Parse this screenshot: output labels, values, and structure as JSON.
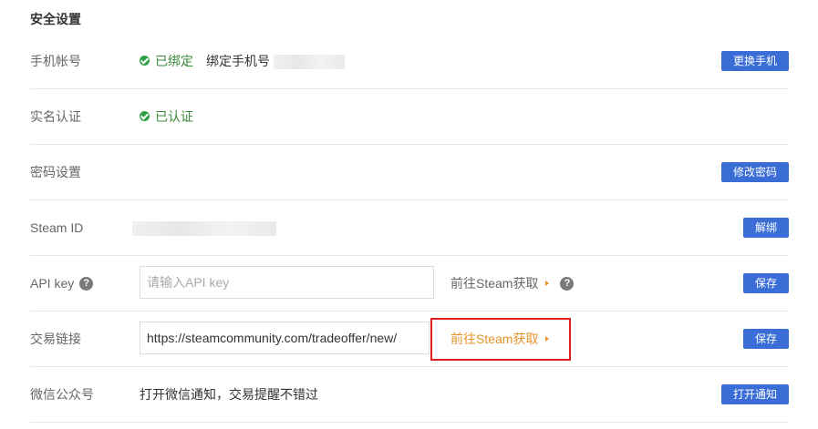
{
  "section_title": "安全设置",
  "phone": {
    "label": "手机帐号",
    "status": "已绑定",
    "bind_text": "绑定手机号",
    "button": "更换手机"
  },
  "realname": {
    "label": "实名认证",
    "status": "已认证"
  },
  "password": {
    "label": "密码设置",
    "button": "修改密码"
  },
  "steam": {
    "label": "Steam ID",
    "button": "解绑"
  },
  "apikey": {
    "label": "API key",
    "placeholder": "请输入API key",
    "link": "前往Steam获取",
    "button": "保存"
  },
  "trade": {
    "label": "交易链接",
    "value": "https://steamcommunity.com/tradeoffer/new/",
    "link": "前往Steam获取",
    "button": "保存"
  },
  "wechat": {
    "label": "微信公众号",
    "text": "打开微信通知，交易提醒不错过",
    "button": "打开通知"
  },
  "colors": {
    "button_bg": "#3a6ed6",
    "link_orange": "#e6942a",
    "success_green": "#2ea043",
    "highlight_red": "#e02020"
  }
}
